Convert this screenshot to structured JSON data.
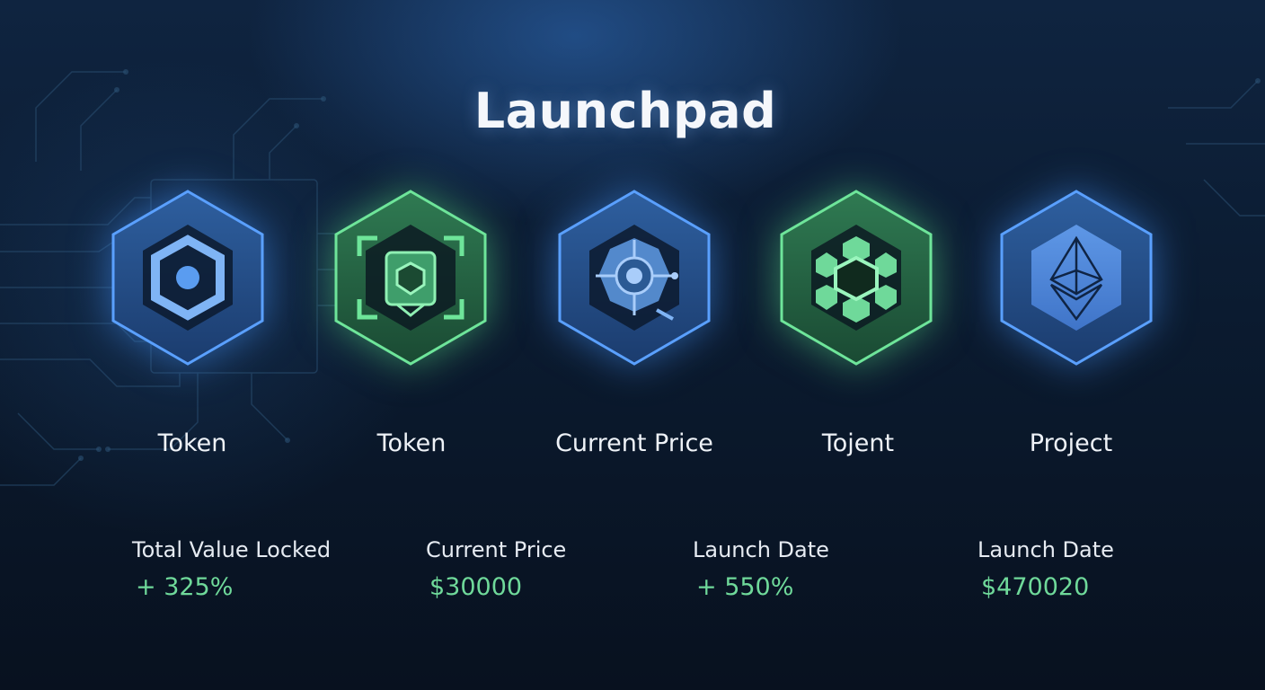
{
  "header": {
    "title": "Launchpad"
  },
  "cards": [
    {
      "label": "Token",
      "icon": "hexagon-ring-icon",
      "accent": "#4a8fe8"
    },
    {
      "label": "Token",
      "icon": "shield-chip-icon",
      "accent": "#5fd88a"
    },
    {
      "label": "Current Price",
      "icon": "gear-network-icon",
      "accent": "#4a8fe8"
    },
    {
      "label": "Tojent",
      "icon": "hexagon-cluster-icon",
      "accent": "#5fd88a"
    },
    {
      "label": "Project",
      "icon": "ethereum-icon",
      "accent": "#4a8fe8"
    }
  ],
  "stats": [
    {
      "label": "Total Value Locked",
      "value": "+ 325%"
    },
    {
      "label": "Current Price",
      "value": "$30000"
    },
    {
      "label": "Launch Date",
      "value": "+ 550%"
    },
    {
      "label": "Launch Date",
      "value": "$470020"
    }
  ],
  "colors": {
    "background": "#0b1b30",
    "blue_accent": "#4a8fe8",
    "green_accent": "#5fd88a",
    "value_text": "#6fd99a"
  }
}
